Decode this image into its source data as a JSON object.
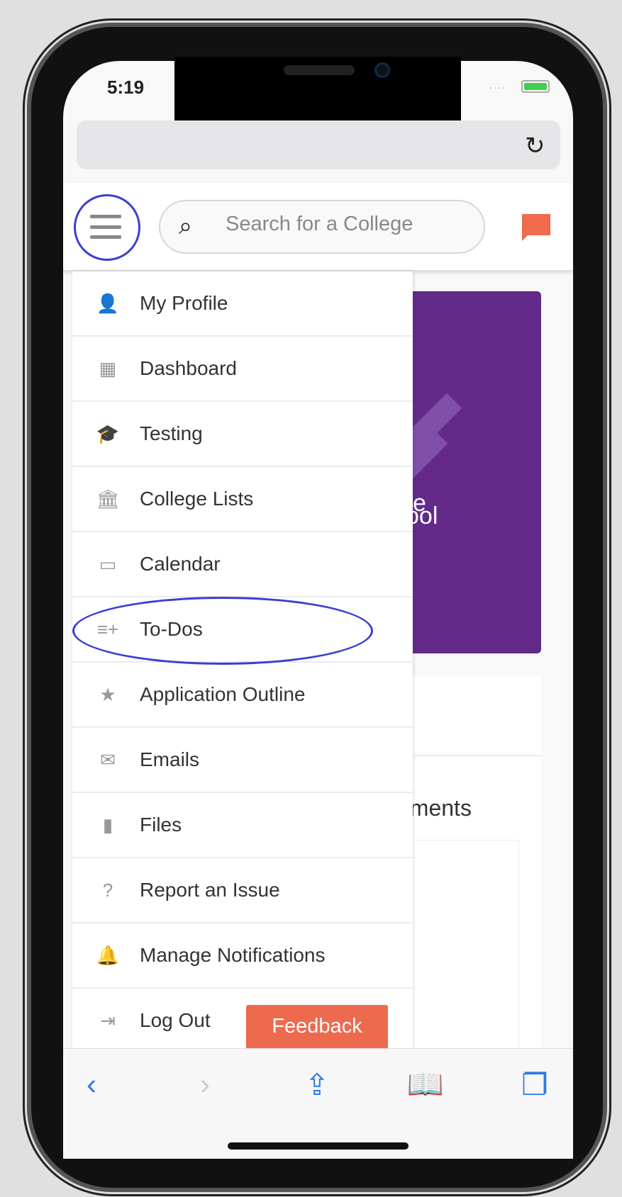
{
  "status_bar": {
    "time": "5:19",
    "signal": "....",
    "battery": "charging"
  },
  "browser": {
    "reload_icon": "reload-icon"
  },
  "header": {
    "search_placeholder": "Search for a College",
    "menu_icon": "hamburger-icon",
    "chat_icon": "chat-icon",
    "accent": "#ef6a4e"
  },
  "background": {
    "banner_color": "#632a8a",
    "banner_text_1": "e",
    "banner_text_2": "ool",
    "section_text": "ements"
  },
  "menu": {
    "items": [
      {
        "label": "My Profile",
        "icon": "person-icon",
        "glyph": "👤"
      },
      {
        "label": "Dashboard",
        "icon": "dashboard-icon",
        "glyph": "▦"
      },
      {
        "label": "Testing",
        "icon": "graduation-cap-icon",
        "glyph": "🎓"
      },
      {
        "label": "College Lists",
        "icon": "institution-icon",
        "glyph": "🏛"
      },
      {
        "label": "Calendar",
        "icon": "calendar-icon",
        "glyph": "▭"
      },
      {
        "label": "To-Dos",
        "icon": "playlist-add-icon",
        "glyph": "≡+"
      },
      {
        "label": "Application Outline",
        "icon": "star-icon",
        "glyph": "★"
      },
      {
        "label": "Emails",
        "icon": "mail-icon",
        "glyph": "✉"
      },
      {
        "label": "Files",
        "icon": "file-icon",
        "glyph": "▮"
      },
      {
        "label": "Report an Issue",
        "icon": "help-icon",
        "glyph": "?"
      },
      {
        "label": "Manage Notifications",
        "icon": "bell-icon",
        "glyph": "🔔"
      },
      {
        "label": "Log Out",
        "icon": "logout-icon",
        "glyph": "⇥"
      }
    ]
  },
  "feedback": {
    "label": "Feedback",
    "color": "#ee6a4f"
  },
  "toolbar": {
    "back": "‹",
    "forward": "›",
    "share": "⇪",
    "bookmarks": "📖",
    "tabs": "❐"
  }
}
